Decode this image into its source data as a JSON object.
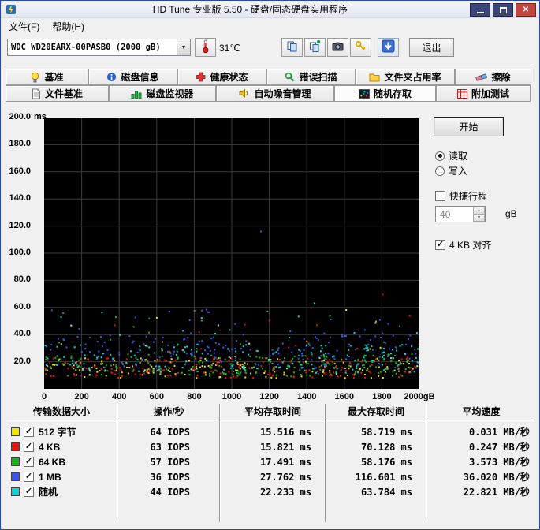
{
  "window": {
    "title": "HD Tune 专业版 5.50 - 硬盘/固态硬盘实用程序",
    "border_color": "#2a46b0"
  },
  "menu": {
    "items": [
      {
        "id": "file",
        "label": "文件(F)"
      },
      {
        "id": "help",
        "label": "帮助(H)"
      }
    ]
  },
  "toolbar": {
    "drive_selected": "WDC WD20EARX-00PASB0 (2000 gB)",
    "temperature": "31℃",
    "exit_label": "退出"
  },
  "tabs": {
    "active": "随机存取",
    "row1": [
      {
        "id": "benchmark",
        "label": "基准",
        "icon": "bulb-icon"
      },
      {
        "id": "disk-info",
        "label": "磁盘信息",
        "icon": "info-icon"
      },
      {
        "id": "health",
        "label": "健康状态",
        "icon": "health-cross-icon"
      },
      {
        "id": "error-scan",
        "label": "错误扫描",
        "icon": "magnifier-icon"
      },
      {
        "id": "folder-usage",
        "label": "文件夹占用率",
        "icon": "folder-icon"
      },
      {
        "id": "erase",
        "label": "擦除",
        "icon": "eraser-icon"
      }
    ],
    "row2": [
      {
        "id": "file-benchmark",
        "label": "文件基准",
        "icon": "file-page-icon"
      },
      {
        "id": "disk-monitor",
        "label": "磁盘监视器",
        "icon": "bar-monitor-icon"
      },
      {
        "id": "aam",
        "label": "自动噪音管理",
        "icon": "speaker-icon"
      },
      {
        "id": "random-access",
        "label": "随机存取",
        "icon": "random-dots-icon"
      },
      {
        "id": "extra-tests",
        "label": "附加测试",
        "icon": "extra-tests-icon"
      }
    ]
  },
  "controls": {
    "start_label": "开始",
    "read_label": "读取",
    "write_label": "写入",
    "read_selected": true,
    "write_selected": false,
    "short_stroke_label": "快捷行程",
    "short_stroke_checked": false,
    "short_stroke_value": "40",
    "short_stroke_unit": "gB",
    "align_label": "4 KB 对齐",
    "align_checked": true
  },
  "chart_data": {
    "type": "scatter",
    "title": "",
    "x_unit": "gB",
    "y_unit": "ms",
    "xlim": [
      0,
      2000
    ],
    "ylim": [
      0,
      200
    ],
    "grid": true,
    "background": "#000000",
    "ytick_labels": [
      "200.0",
      "180.0",
      "160.0",
      "140.0",
      "120.0",
      "100.0",
      "80.0",
      "60.0",
      "40.0",
      "20.0"
    ],
    "xtick_labels": [
      "0",
      "200",
      "400",
      "600",
      "800",
      "1000",
      "1200",
      "1400",
      "1600",
      "1800",
      "2000gB"
    ],
    "series": [
      {
        "name": "512 字节",
        "color": "#f0e400",
        "avg_ms": 15.516,
        "max_ms": 58.719
      },
      {
        "name": "4 KB",
        "color": "#e81410",
        "avg_ms": 15.821,
        "max_ms": 70.128
      },
      {
        "name": "64 KB",
        "color": "#17b417",
        "avg_ms": 17.491,
        "max_ms": 58.176
      },
      {
        "name": "1 MB",
        "color": "#3c55e8",
        "avg_ms": 27.762,
        "max_ms": 116.601
      },
      {
        "name": "随机",
        "color": "#14d2d2",
        "avg_ms": 22.233,
        "max_ms": 63.784
      }
    ]
  },
  "table": {
    "headers": [
      "传输数据大小",
      "操作/秒",
      "平均存取时间",
      "最大存取时间",
      "平均速度"
    ],
    "rows": [
      {
        "label": "512 字节",
        "color": "#f0e400",
        "checked": true,
        "ops": "64",
        "ops_unit": "IOPS",
        "avg": "15.516",
        "avg_unit": "ms",
        "max": "58.719",
        "max_unit": "ms",
        "speed": "0.031",
        "speed_unit": "MB/秒"
      },
      {
        "label": "4 KB",
        "color": "#e81410",
        "checked": true,
        "ops": "63",
        "ops_unit": "IOPS",
        "avg": "15.821",
        "avg_unit": "ms",
        "max": "70.128",
        "max_unit": "ms",
        "speed": "0.247",
        "speed_unit": "MB/秒"
      },
      {
        "label": "64 KB",
        "color": "#17b417",
        "checked": true,
        "ops": "57",
        "ops_unit": "IOPS",
        "avg": "17.491",
        "avg_unit": "ms",
        "max": "58.176",
        "max_unit": "ms",
        "speed": "3.573",
        "speed_unit": "MB/秒"
      },
      {
        "label": "1 MB",
        "color": "#3c55e8",
        "checked": true,
        "ops": "36",
        "ops_unit": "IOPS",
        "avg": "27.762",
        "avg_unit": "ms",
        "max": "116.601",
        "max_unit": "ms",
        "speed": "36.020",
        "speed_unit": "MB/秒"
      },
      {
        "label": "随机",
        "color": "#14d2d2",
        "checked": true,
        "ops": "44",
        "ops_unit": "IOPS",
        "avg": "22.233",
        "avg_unit": "ms",
        "max": "63.784",
        "max_unit": "ms",
        "speed": "22.821",
        "speed_unit": "MB/秒"
      }
    ]
  }
}
